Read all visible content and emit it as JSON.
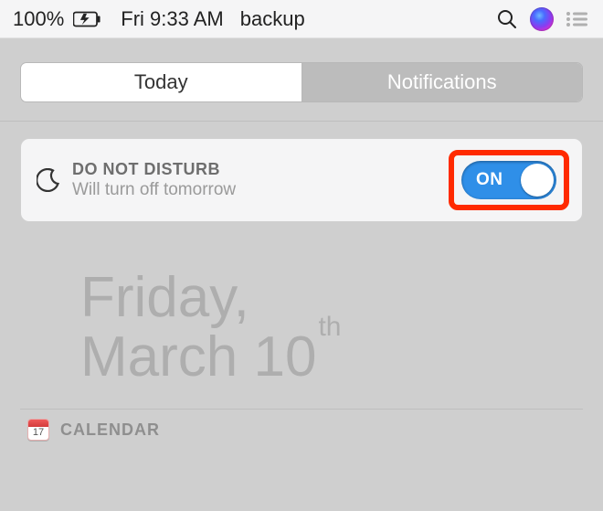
{
  "menubar": {
    "battery_pct": "100%",
    "clock": "Fri 9:33 AM",
    "backup_label": "backup"
  },
  "tabs": {
    "today": "Today",
    "notifications": "Notifications",
    "active": "today"
  },
  "dnd": {
    "title": "DO NOT DISTURB",
    "subtitle": "Will turn off tomorrow",
    "toggle_label": "ON",
    "toggle_state": true
  },
  "date": {
    "line1": "Friday,",
    "line2_main": "March 10",
    "line2_suffix": "th"
  },
  "calendar": {
    "icon_day": "17",
    "label": "CALENDAR"
  },
  "highlight": {
    "color": "#ff2a00"
  }
}
